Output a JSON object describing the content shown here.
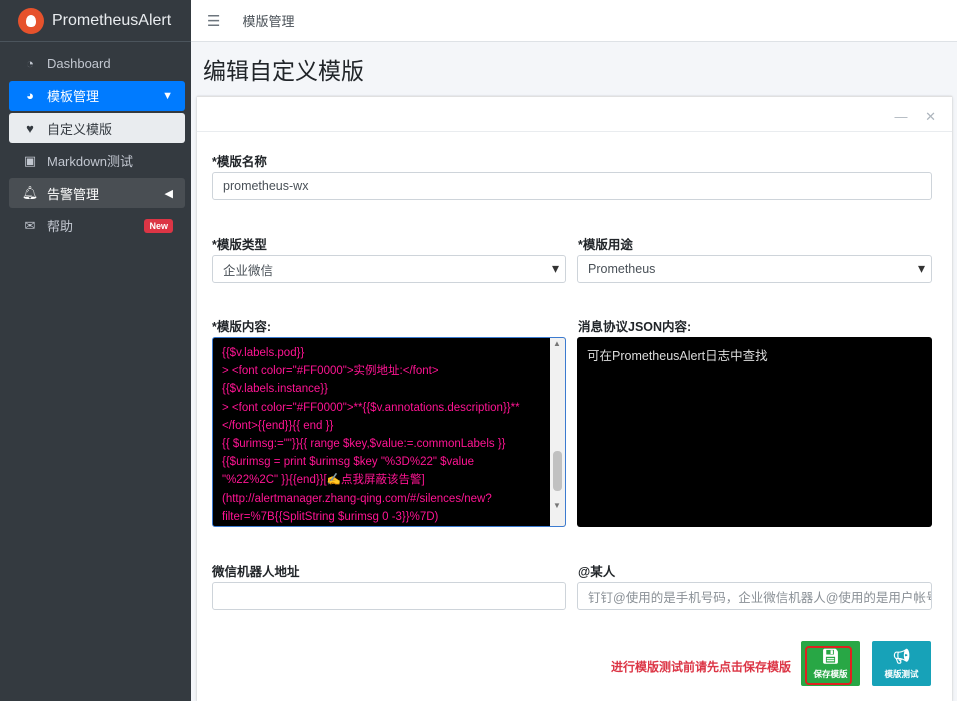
{
  "brand": {
    "name": "PrometheusAlert"
  },
  "sidebar": {
    "items": [
      {
        "label": "Dashboard",
        "icon": "dashboard-icon"
      },
      {
        "label": "模板管理",
        "icon": "pie-chart-icon"
      },
      {
        "label": "自定义模版",
        "icon": "heart-icon"
      },
      {
        "label": "Markdown测试",
        "icon": "image-icon"
      },
      {
        "label": "告警管理",
        "icon": "bell-icon"
      },
      {
        "label": "帮助",
        "icon": "envelope-icon",
        "badge": "New"
      }
    ]
  },
  "topbar": {
    "breadcrumb": "模版管理"
  },
  "page": {
    "title": "编辑自定义模版"
  },
  "form": {
    "name_label": "*模版名称",
    "name_value": "prometheus-wx",
    "type_label": "*模版类型",
    "type_value": "企业微信",
    "usage_label": "*模版用途",
    "usage_value": "Prometheus",
    "content_label": "*模版内容:",
    "content_lines": [
      "{{$v.labels.pod}}",
      "> <font color=\"#FF0000\">实例地址:</font>",
      "{{$v.labels.instance}}",
      "> <font color=\"#FF0000\">**{{$v.annotations.description}}**",
      "</font>{{end}}{{ end }}",
      "{{ $urimsg:=\"\"}}{{ range $key,$value:=.commonLabels }}",
      "{{$urimsg =  print $urimsg $key \"%3D%22\" $value",
      "\"%22%2C\" }}{{end}}[✍️点我屏蔽该告警]",
      "(http://alertmanager.zhang-qing.com/#/silences/new?",
      "filter=%7B{{SplitString $urimsg 0 -3}}%7D)"
    ],
    "json_label": "消息协议JSON内容:",
    "json_text": "可在PrometheusAlert日志中查找",
    "wechat_label": "微信机器人地址",
    "wechat_value": "",
    "at_label": "@某人",
    "at_placeholder": "钉钉@使用的是手机号码，企业微信机器人@使用的是用户帐号"
  },
  "actions": {
    "warning": "进行模版测试前请先点击保存模版",
    "save_label": "保存模版",
    "test_label": "模版测试"
  },
  "colors": {
    "accent": "#007bff",
    "save": "#28a745",
    "test": "#17a2b8",
    "warning": "#dc3545",
    "code_text": "#ff1493"
  }
}
